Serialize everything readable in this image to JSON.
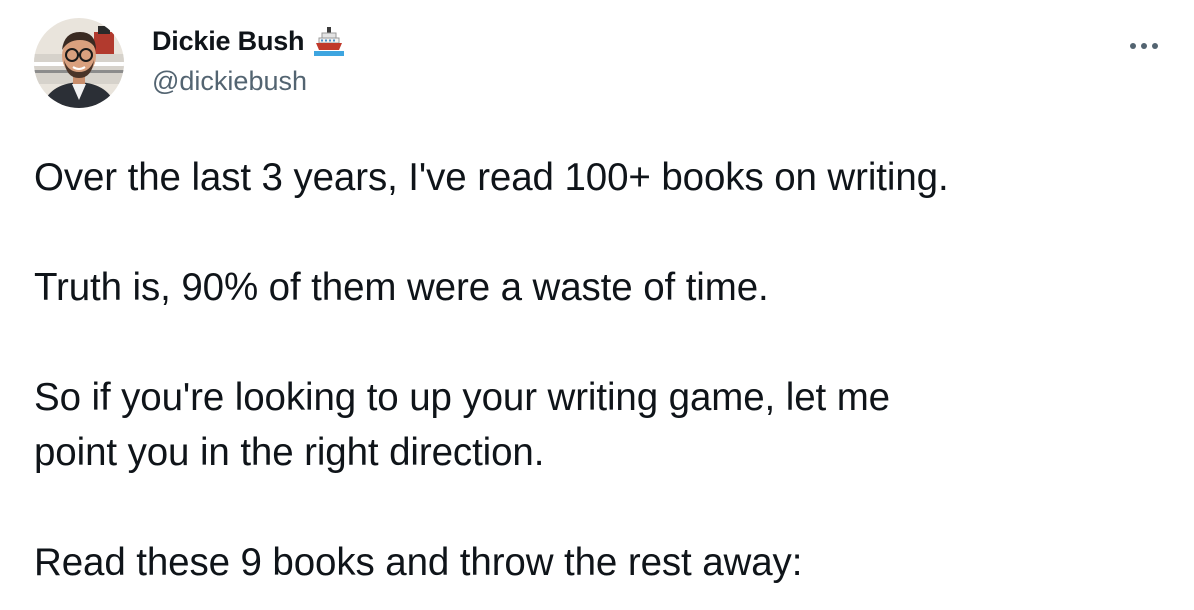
{
  "author": {
    "display_name": "Dickie Bush",
    "handle": "@dickiebush",
    "name_emoji_icon": "ship-icon",
    "avatar_icon": "avatar-photo"
  },
  "menu": {
    "more_icon": "more-horizontal-icon"
  },
  "tweet": {
    "paragraphs": [
      "Over the last 3 years, I've read 100+ books on writing.",
      "Truth is, 90% of them were a waste of time.",
      "So if you're looking to up your writing game, let me\npoint you in the right direction.",
      "Read these 9 books and throw the rest away:"
    ]
  },
  "colors": {
    "text": "#0f1419",
    "secondary": "#536471",
    "background": "#ffffff"
  }
}
